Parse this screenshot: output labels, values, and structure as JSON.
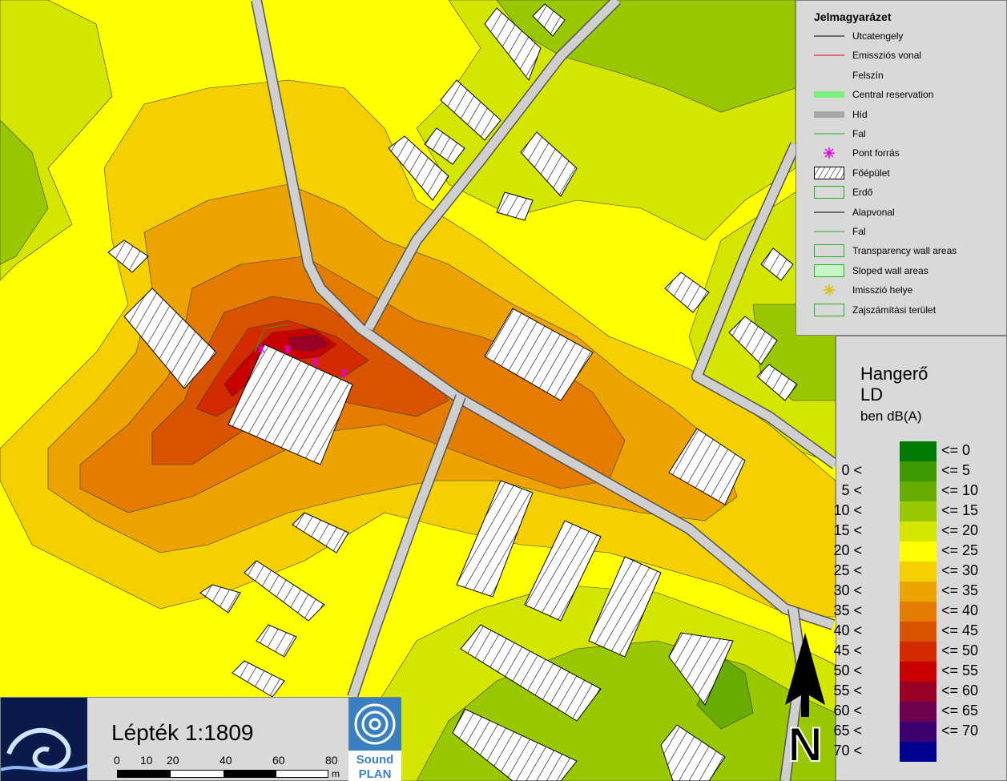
{
  "legend": {
    "title": "Jelmagyarázet",
    "items": [
      {
        "label": "Utcatengely",
        "icon": "line-black-icon"
      },
      {
        "label": "Emissziós vonal",
        "icon": "line-red-icon"
      },
      {
        "label": "Felszín",
        "icon": "blank-icon"
      },
      {
        "label": "Central reservation",
        "icon": "bar-green-icon"
      },
      {
        "label": "Híd",
        "icon": "bar-grey-icon"
      },
      {
        "label": "Fal",
        "icon": "line-green-icon"
      },
      {
        "label": "Pont forrás",
        "icon": "asterisk-magenta-icon"
      },
      {
        "label": "Főépület",
        "icon": "hatched-box-icon"
      },
      {
        "label": "Erdő",
        "icon": "green-outline-box-icon"
      },
      {
        "label": "Alapvonal",
        "icon": "line-black-icon"
      },
      {
        "label": "Fal",
        "icon": "line-green-icon"
      },
      {
        "label": "Transparency wall areas",
        "icon": "green-outline-box-icon"
      },
      {
        "label": "Sloped wall areas",
        "icon": "light-green-box-icon"
      },
      {
        "label": "Imisszió helye",
        "icon": "asterisk-yellow-icon"
      },
      {
        "label": "Zajszámítási terület",
        "icon": "green-outline-box-icon"
      }
    ]
  },
  "color_scale": {
    "title_line1": "Hangerő",
    "title_line2": "LD",
    "subtitle": "ben dB(A)",
    "classes": [
      {
        "left": "",
        "right": "<= 0",
        "color": "#007a00"
      },
      {
        "left": "0 <",
        "right": "<= 5",
        "color": "#3c9a00"
      },
      {
        "left": "5 <",
        "right": "<= 10",
        "color": "#66ad00"
      },
      {
        "left": "10 <",
        "right": "<= 15",
        "color": "#99c800"
      },
      {
        "left": "15 <",
        "right": "<= 20",
        "color": "#d4e600"
      },
      {
        "left": "20 <",
        "right": "<= 25",
        "color": "#ffff00"
      },
      {
        "left": "25 <",
        "right": "<= 30",
        "color": "#f5d000"
      },
      {
        "left": "30 <",
        "right": "<= 35",
        "color": "#eea400"
      },
      {
        "left": "35 <",
        "right": "<= 40",
        "color": "#e47c00"
      },
      {
        "left": "40 <",
        "right": "<= 45",
        "color": "#d85400"
      },
      {
        "left": "45 <",
        "right": "<= 50",
        "color": "#d42a00"
      },
      {
        "left": "50 <",
        "right": "<= 55",
        "color": "#c80000"
      },
      {
        "left": "55 <",
        "right": "<= 60",
        "color": "#9a0026"
      },
      {
        "left": "60 <",
        "right": "<= 65",
        "color": "#6e0050"
      },
      {
        "left": "65 <",
        "right": "<= 70",
        "color": "#3c0070"
      },
      {
        "left": "70 <",
        "right": "",
        "color": "#000090"
      }
    ]
  },
  "scale": {
    "text": "Lépték 1:1809",
    "ticks": [
      "0",
      "10",
      "20",
      "40",
      "60",
      "80"
    ],
    "unit": "m"
  },
  "logo": {
    "line1": "Sound",
    "line2": "PLAN"
  },
  "north_arrow": {
    "letter": "N",
    "icon": "north-arrow-icon"
  }
}
